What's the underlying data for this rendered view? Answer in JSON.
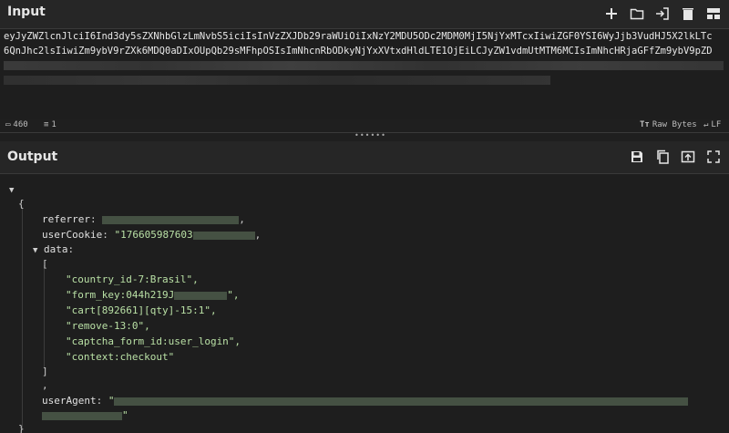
{
  "input": {
    "title": "Input",
    "toolbar_icons": [
      "plus-icon",
      "folder-icon",
      "import-icon",
      "trash-icon",
      "layout-icon"
    ],
    "lines": [
      "eyJyZWZlcnJlciI6Ind3dy5sZXNhbGlzLmNvbS5iciIsInVzZXJDb29raWUiOiIxNzY2MDU5ODc2MDM0MjI5NjYxMTcxIiwiZGF0YSI6WyJjb3VudHJ5X2lkLTc",
      "6QnJhc2lsIiwiZm9ybV9rZXk6MDQ0aDIxOUpQb29sMFhpOSIsImNhcnRbODkyNjYxXVtxdHldLTE1OjEiLCJyZW1vdmUtMTM6MCIsImNhcHRjaGFfZm9ybV9pZD"
    ],
    "status": {
      "length_label": "460",
      "lines_label": "1",
      "raw_bytes": "Raw Bytes",
      "lf": "LF"
    }
  },
  "output": {
    "title": "Output",
    "toolbar_icons": [
      "save-icon",
      "copy-icon",
      "replace-input-icon",
      "fullscreen-icon"
    ],
    "json": {
      "referrer_key": "referrer",
      "usercookie_key": "userCookie",
      "usercookie_visible": "\"176605987603",
      "data_key": "data",
      "items": [
        "\"country_id-7:Brasil\",",
        "\"form_key:044h219J",
        "\"cart[892661][qty]-15:1\",",
        "\"remove-13:0\",",
        "\"captcha_form_id:user_login\",",
        "\"context:checkout\""
      ],
      "useragent_key": "userAgent"
    }
  },
  "colors": {
    "background": "#1f1f1f",
    "header": "#262626",
    "string": "#b9e0a5",
    "redaction": "#4c5b4a"
  }
}
